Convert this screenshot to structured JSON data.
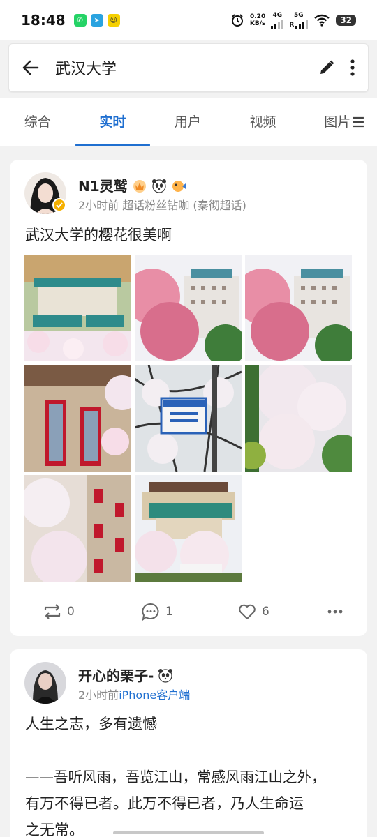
{
  "status_bar": {
    "time": "18:48",
    "net_speed_value": "0.20",
    "net_speed_unit": "KB/s",
    "sim1": "4G",
    "sim2": "5G",
    "sim2_sub": "R",
    "battery": "32"
  },
  "search": {
    "query": "武汉大学"
  },
  "tabs": [
    {
      "label": "综合",
      "active": false
    },
    {
      "label": "实时",
      "active": true
    },
    {
      "label": "用户",
      "active": false
    },
    {
      "label": "视频",
      "active": false
    },
    {
      "label": "图片",
      "active": false
    }
  ],
  "colors": {
    "accent": "#1f6fd0",
    "background": "#f2f2f2",
    "card": "#ffffff",
    "muted_text": "#888888"
  },
  "posts": [
    {
      "username": "N1灵鹫",
      "time": "2小时前",
      "source": "超话粉丝钻咖 (秦彻超话)",
      "text": "武汉大学的樱花很美啊",
      "image_count": 8,
      "reposts": "0",
      "comments": "1",
      "likes": "6"
    },
    {
      "username": "开心的栗子-",
      "time": "2小时前",
      "source": "iPhone客户端",
      "text_lines": [
        "人生之志，多有遗憾",
        "",
        "——吾听风雨，吾览江山，常感风雨江山之外，",
        "有万不得已者。此万不得已者，乃人生命运",
        "之无常。"
      ]
    }
  ]
}
